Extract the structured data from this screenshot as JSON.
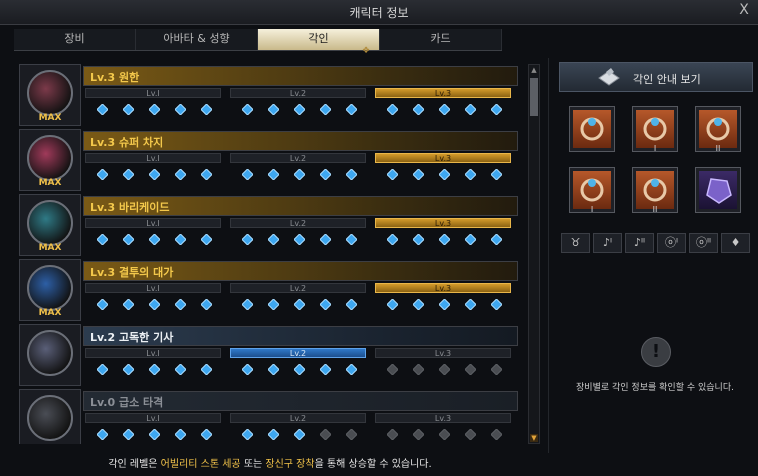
{
  "window": {
    "title": "캐릭터 정보",
    "close": "X"
  },
  "tabs": [
    {
      "label": "장비",
      "active": false
    },
    {
      "label": "아바타 & 성향",
      "active": false
    },
    {
      "label": "각인",
      "active": true
    },
    {
      "label": "카드",
      "active": false
    }
  ],
  "segment_labels": [
    "Lv.I",
    "Lv.2",
    "Lv.3"
  ],
  "engravings": [
    {
      "name": "Lv.3 원한",
      "max": "MAX",
      "style": "gold",
      "level": 3,
      "gems_filled": 15,
      "orb": "#7c3a4a"
    },
    {
      "name": "Lv.3 슈퍼 차지",
      "max": "MAX",
      "style": "gold",
      "level": 3,
      "gems_filled": 15,
      "orb": "#a03a5a"
    },
    {
      "name": "Lv.3 바리케이드",
      "max": "MAX",
      "style": "gold",
      "level": 3,
      "gems_filled": 15,
      "orb": "#2f7a86"
    },
    {
      "name": "Lv.3 결투의 대가",
      "max": "MAX",
      "style": "gold",
      "level": 3,
      "gems_filled": 15,
      "orb": "#2d5fa6"
    },
    {
      "name": "Lv.2 고독한 기사",
      "max": "",
      "style": "blue",
      "level": 2,
      "gems_filled": 10,
      "orb": "#5a5f78"
    },
    {
      "name": "Lv.0 급소 타격",
      "max": "",
      "style": "gray",
      "level": 0,
      "gems_filled": 8,
      "orb": "#4a4d55"
    }
  ],
  "guide_button": {
    "label": "각인 안내 보기"
  },
  "equipment_slots": [
    {
      "name": "necklace",
      "num": "",
      "kind": "orange"
    },
    {
      "name": "earring",
      "num": "I",
      "kind": "orange"
    },
    {
      "name": "earring",
      "num": "II",
      "kind": "orange"
    },
    {
      "name": "ring",
      "num": "I",
      "kind": "orange"
    },
    {
      "name": "ring",
      "num": "II",
      "kind": "orange"
    },
    {
      "name": "ability-stone",
      "num": "",
      "kind": "purple"
    }
  ],
  "category_filters": [
    {
      "glyph": "♉",
      "name": "necklace"
    },
    {
      "glyph": "♪ᴵ",
      "name": "earring-1"
    },
    {
      "glyph": "♪ᴵᴵ",
      "name": "earring-2"
    },
    {
      "glyph": "ⓞᴵ",
      "name": "ring-1"
    },
    {
      "glyph": "ⓞᴵᴵ",
      "name": "ring-2"
    },
    {
      "glyph": "♦",
      "name": "stone"
    }
  ],
  "info": {
    "icon": "!",
    "text": "장비별로 각인 정보를 확인할 수 있습니다."
  },
  "footer": {
    "prefix": "각인 레벨은 ",
    "h1": "어빌리티 스톤 세공",
    "mid": " 또는 ",
    "h2": "장신구 장착",
    "suffix": "을 통해 상승할 수 있습니다."
  },
  "colors": {
    "gold": "#f3c84b",
    "gem_blue": "#3ea7f0",
    "gem_empty": "#4a4d52",
    "accent_blue": "#2f79c9"
  }
}
